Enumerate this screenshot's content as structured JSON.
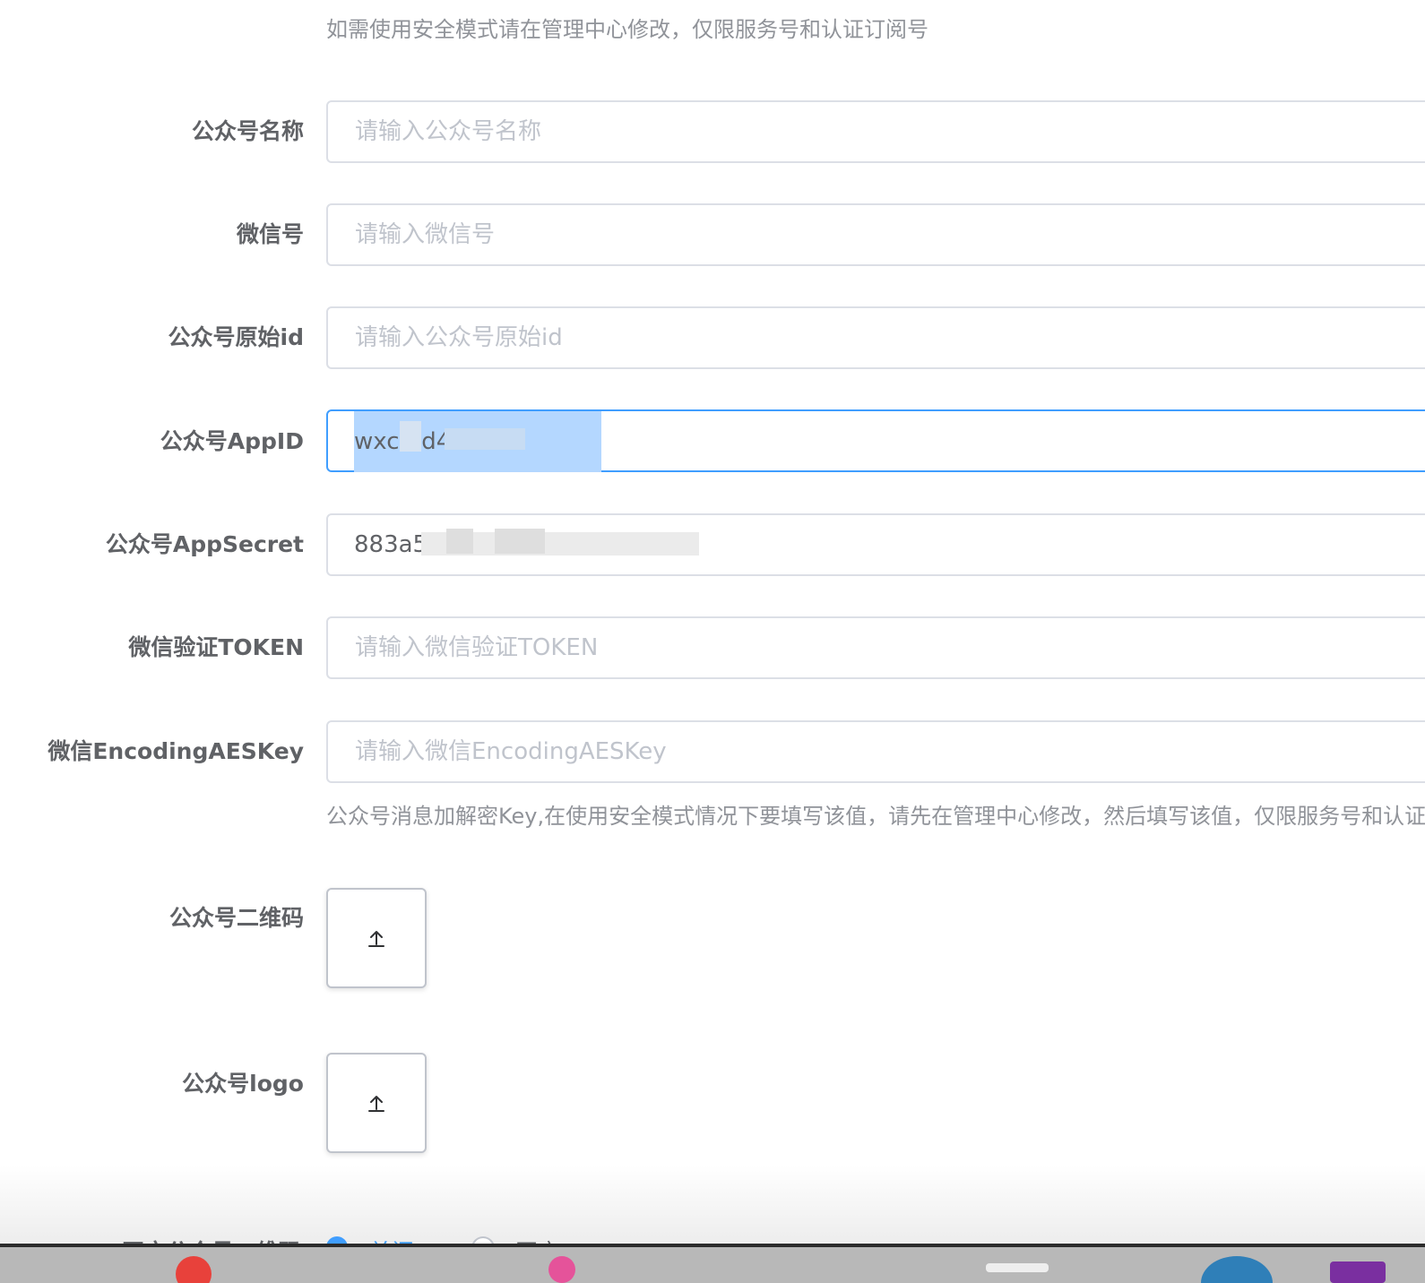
{
  "form": {
    "top_hint": "如需使用安全模式请在管理中心修改，仅限服务号和认证订阅号",
    "fields": [
      {
        "label": "公众号名称",
        "placeholder": "请输入公众号名称",
        "value": ""
      },
      {
        "label": "微信号",
        "placeholder": "请输入微信号",
        "value": ""
      },
      {
        "label": "公众号原始id",
        "placeholder": "请输入公众号原始id",
        "value": ""
      },
      {
        "label": "公众号AppID",
        "placeholder": "",
        "value": "wxc          3d4d6"
      },
      {
        "label": "公众号AppSecret",
        "placeholder": "",
        "value": "883a5                              a2eda7f7"
      },
      {
        "label": "微信验证TOKEN",
        "placeholder": "请输入微信验证TOKEN",
        "value": ""
      },
      {
        "label": "微信EncodingAESKey",
        "placeholder": "请输入微信EncodingAESKey",
        "value": ""
      }
    ],
    "aes_hint": "公众号消息加解密Key,在使用安全模式情况下要填写该值，请先在管理中心修改，然后填写该值，仅限服务号和认证订阅号",
    "uploads": [
      {
        "label": "公众号二维码",
        "icon": "upload-arrow-icon"
      },
      {
        "label": "公众号logo",
        "icon": "upload-arrow-icon"
      }
    ],
    "partial_row": {
      "label": "开启公众号二维码",
      "options": [
        "关闭",
        "开启"
      ]
    }
  },
  "colors": {
    "primary": "#409eff",
    "border": "#dcdfe6",
    "placeholder": "#c0c4cc",
    "label": "#606266",
    "hint": "#909399",
    "selection": "#b4d7ff"
  }
}
